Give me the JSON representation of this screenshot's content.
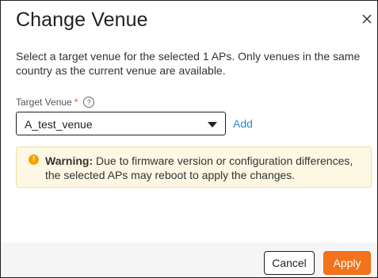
{
  "dialog": {
    "title": "Change Venue",
    "description": "Select a target venue for the selected 1 APs. Only venues in the same country as the current venue are available.",
    "close_icon": "close-icon"
  },
  "field": {
    "label": "Target Venue",
    "required_mark": "*",
    "help_icon": "?",
    "selected_value": "A_test_venue",
    "add_label": "Add"
  },
  "alert": {
    "icon": "!",
    "title": "Warning:",
    "message": "Due to firmware version or configuration differences, the selected APs may reboot to apply the changes."
  },
  "footer": {
    "cancel_label": "Cancel",
    "apply_label": "Apply"
  },
  "colors": {
    "accent": "#f2731c",
    "link": "#3b82d6",
    "warning": "#f5a200",
    "required": "#e05a2b"
  }
}
